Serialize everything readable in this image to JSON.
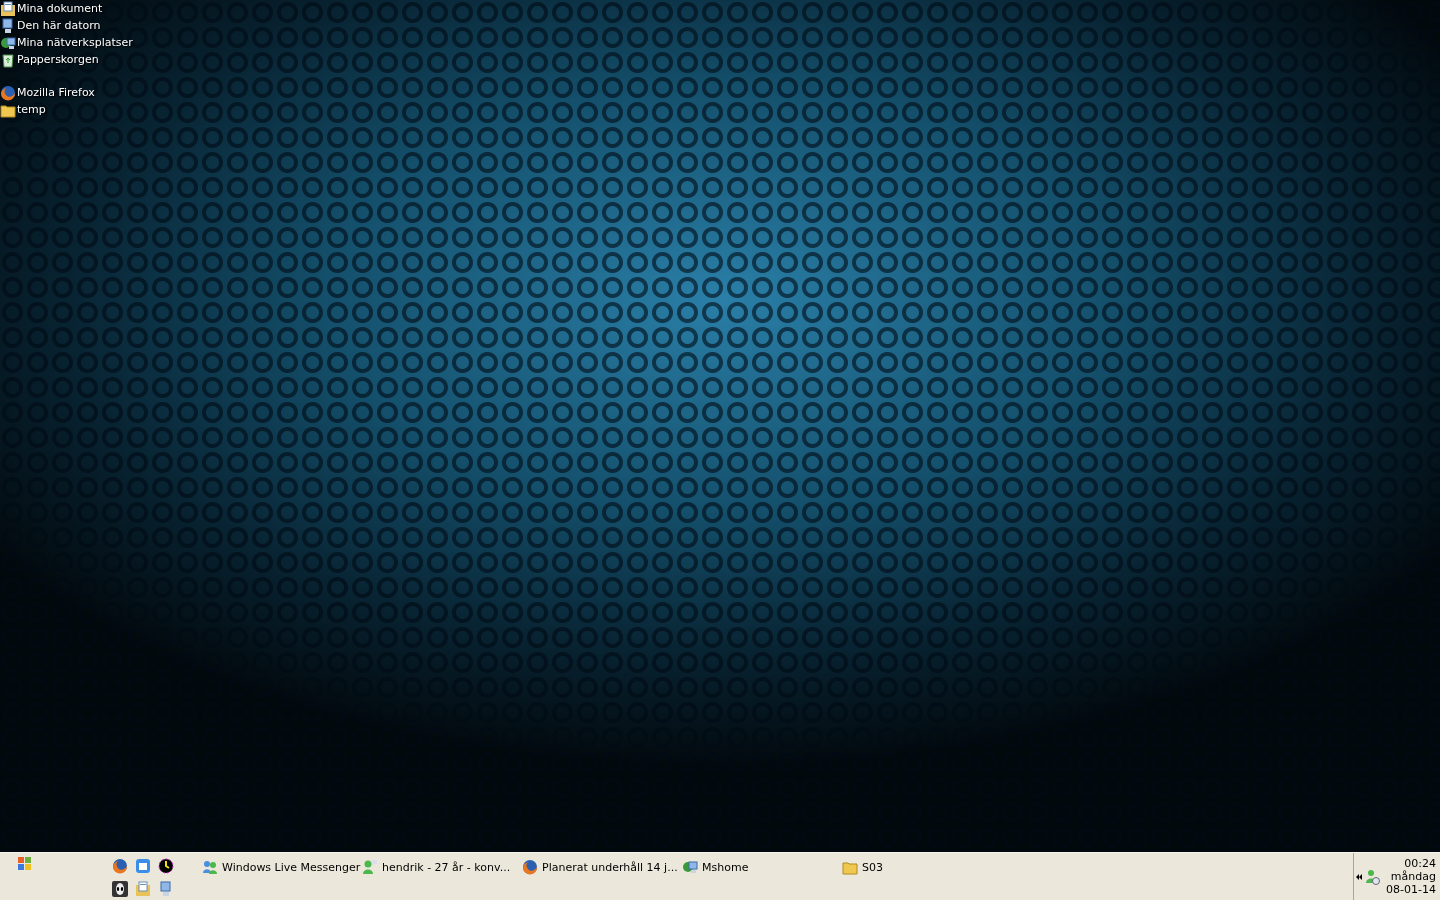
{
  "desktop_icon_groups": [
    {
      "items": [
        {
          "kind": "documents",
          "label": "Mina dokument"
        },
        {
          "kind": "computer",
          "label": "Den här datorn"
        },
        {
          "kind": "network",
          "label": "Mina nätverksplatser"
        },
        {
          "kind": "recycle",
          "label": "Papperskorgen"
        }
      ]
    },
    {
      "items": [
        {
          "kind": "browser",
          "label": "Mozilla Firefox"
        },
        {
          "kind": "folder",
          "label": "temp"
        }
      ]
    }
  ],
  "taskbar": {
    "quick_launch": [
      {
        "kind": "browser"
      },
      {
        "kind": "mail"
      },
      {
        "kind": "clock"
      },
      {
        "kind": "alien"
      },
      {
        "kind": "documents"
      },
      {
        "kind": "computer"
      }
    ],
    "buttons": [
      {
        "kind": "messenger",
        "label": "Windows Live Messenger"
      },
      {
        "kind": "chat",
        "label": "hendrik - 27 år - konv..."
      },
      {
        "kind": "browser",
        "label": "Planerat underhåll 14 j..."
      },
      {
        "kind": "network",
        "label": "Mshome"
      },
      {
        "kind": "folder",
        "label": "S03"
      }
    ],
    "tray": {
      "time": "00:24",
      "day": "måndag",
      "date": "08-01-14"
    }
  }
}
